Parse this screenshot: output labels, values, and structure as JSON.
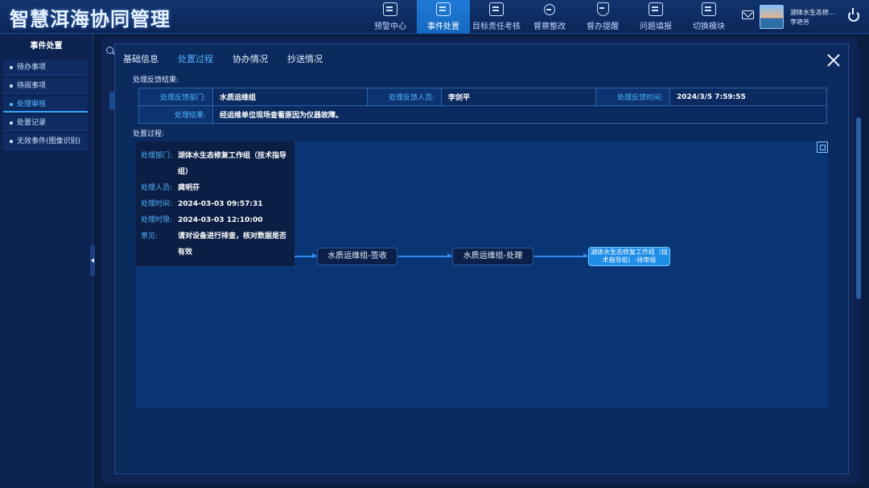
{
  "app": {
    "title": "智慧洱海协同管理"
  },
  "nav": {
    "items": [
      {
        "label": "预警中心",
        "icon": "monitor-icon"
      },
      {
        "label": "事件处置",
        "icon": "clipboard-icon"
      },
      {
        "label": "目标责任考核",
        "icon": "checklist-icon"
      },
      {
        "label": "督察整改",
        "icon": "person-icon"
      },
      {
        "label": "督办提醒",
        "icon": "shield-icon"
      },
      {
        "label": "问题填报",
        "icon": "upload-icon"
      },
      {
        "label": "切换模块",
        "icon": "switch-icon"
      }
    ]
  },
  "user": {
    "org": "湖体水生态修...",
    "name": "李艳芳"
  },
  "sidebar": {
    "title": "事件处置",
    "items": [
      {
        "label": "待办事项"
      },
      {
        "label": "待阅事项"
      },
      {
        "label": "处理审核"
      },
      {
        "label": "处置记录"
      },
      {
        "label": "无效事件(图像识别)"
      }
    ]
  },
  "modal": {
    "tabs": [
      {
        "label": "基础信息"
      },
      {
        "label": "处置过程"
      },
      {
        "label": "协办情况"
      },
      {
        "label": "抄送情况"
      }
    ],
    "feedback": {
      "section_label": "处理反馈结果:",
      "dept_label": "处理反馈部门:",
      "dept_value": "水质运维组",
      "person_label": "处理反馈人员:",
      "person_value": "李剑平",
      "time_label": "处理反馈时间:",
      "time_value": "2024/3/5 7:59:55",
      "result_label": "处理结果:",
      "result_value": "经运维单位现场查看原因为仪器故障。"
    },
    "process": {
      "section_label": "处置过程:",
      "tooltip": {
        "dept_label": "处理部门:",
        "dept_value": "湖体水生态修复工作组（技术指导组）",
        "person_label": "处理人员:",
        "person_value": "龚明芬",
        "time_label": "处理时间:",
        "time_value": "2024-03-03 09:57:31",
        "deadline_label": "处理时限:",
        "deadline_value": "2024-03-03 12:10:00",
        "opinion_label": "意见:",
        "opinion_value": "请对设备进行排查，核对数据是否有效"
      },
      "nodes": [
        {
          "label": "水质运维组-签收"
        },
        {
          "label": "水质运维组-处理"
        },
        {
          "label": "湖体水生态修复工作组（技术指导组）-待审核"
        }
      ]
    }
  }
}
